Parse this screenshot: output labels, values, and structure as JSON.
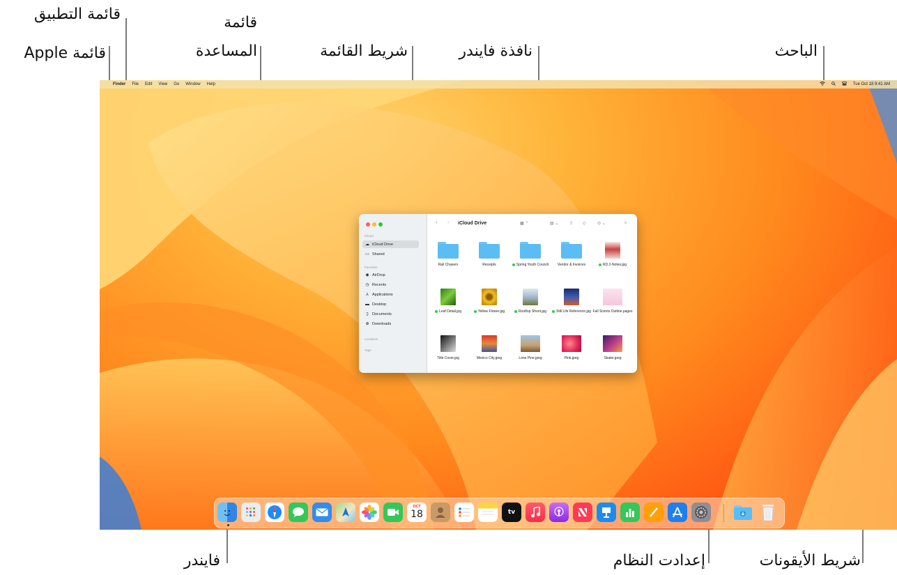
{
  "callouts": {
    "app_menu": "قائمة التطبيق",
    "help_menu_line1": "قائمة",
    "help_menu_line2": "المساعدة",
    "apple_menu": "قائمة Apple",
    "menu_bar": "شريط القائمة",
    "finder_window": "نافذة فايندر",
    "spotlight": "الباحث",
    "finder": "فايندر",
    "system_settings": "إعدادت النظام",
    "dock": "شريط الأيقونات"
  },
  "menubar": {
    "apple_glyph": "",
    "items": [
      "Finder",
      "File",
      "Edit",
      "View",
      "Go",
      "Window",
      "Help"
    ],
    "clock": "Tue Oct 18  9:41 AM"
  },
  "finder_window": {
    "title": "iCloud Drive",
    "sidebar": {
      "section_icloud": "iCloud",
      "icloud_items": [
        "iCloud Drive",
        "Shared"
      ],
      "section_favorites": "Favorites",
      "favorite_items": [
        "AirDrop",
        "Recents",
        "Applications",
        "Desktop",
        "Documents",
        "Downloads"
      ],
      "section_locations": "Locations",
      "section_tags": "Tags"
    },
    "items_row1": [
      "Rail Chasers",
      "Receipts",
      "Spring Youth Council",
      "Vendor & Invoices",
      "RD.2-Notes.jpg"
    ],
    "items_row2": [
      "Leaf Detail.jpg",
      "Yellow Flower.jpg",
      "Rooftop Shoot.jpg",
      "Still Life Reference.jpg",
      "Fall Scents Outline.pages"
    ],
    "items_row3": [
      "Title Cover.jpg",
      "Mexico City.jpeg",
      "Lone Pine.jpeg",
      "Pink.jpeg",
      "Skater.jpeg"
    ]
  },
  "dock": {
    "calendar_month": "OCT",
    "calendar_day": "18",
    "tv_label": "tv"
  },
  "colors": {
    "wallpaper_light": "#ffd36a",
    "wallpaper_dark": "#e8430d",
    "folder_blue": "#5bbdf4",
    "sync_green": "#34c759"
  }
}
